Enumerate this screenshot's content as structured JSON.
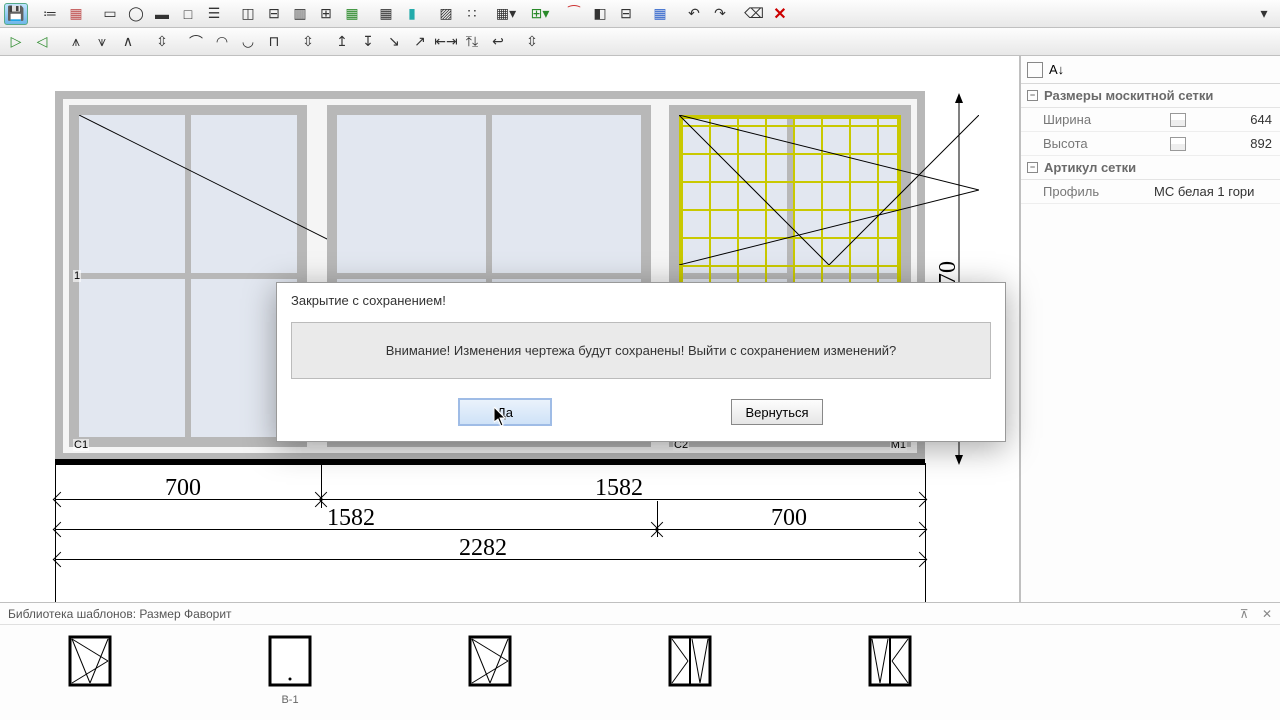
{
  "properties": {
    "group1_title": "Размеры москитной сетки",
    "width_label": "Ширина",
    "width_value": "644",
    "height_label": "Высота",
    "height_value": "892",
    "group2_title": "Артикул сетки",
    "profile_label": "Профиль",
    "profile_value": "МС белая 1 гори"
  },
  "library": {
    "title": "Библиотека шаблонов: Размер Фаворит",
    "item2_caption": "B-1"
  },
  "dimensions": {
    "bottom_a1": "700",
    "bottom_a2": "1582",
    "bottom_b1": "1582",
    "bottom_b2": "700",
    "bottom_total": "2282",
    "right_partial": "70",
    "sash1_mark": "1",
    "c1": "C1",
    "c2": "C2",
    "m1": "M1"
  },
  "dialog": {
    "title": "Закрытие с сохранением!",
    "message": "Внимание! Изменения чертежа будут сохранены! Выйти с сохранением изменений?",
    "yes": "Да",
    "back": "Вернуться"
  }
}
